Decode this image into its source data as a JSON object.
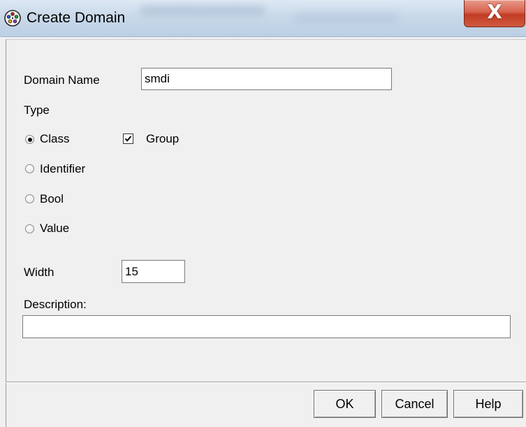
{
  "window": {
    "title": "Create Domain",
    "close_glyph": "X",
    "app_icon": "film-reel-icon",
    "close_color": "#c94a35"
  },
  "form": {
    "domain_name_label": "Domain Name",
    "domain_name_value": "smdi",
    "type_label": "Type",
    "type_options": [
      {
        "label": "Class",
        "selected": true
      },
      {
        "label": "Identifier",
        "selected": false
      },
      {
        "label": "Bool",
        "selected": false
      },
      {
        "label": "Value",
        "selected": false
      }
    ],
    "group_label": "Group",
    "group_checked": true,
    "width_label": "Width",
    "width_value": "15",
    "description_label": "Description:",
    "description_value": ""
  },
  "buttons": {
    "ok": "OK",
    "cancel": "Cancel",
    "help": "Help"
  }
}
